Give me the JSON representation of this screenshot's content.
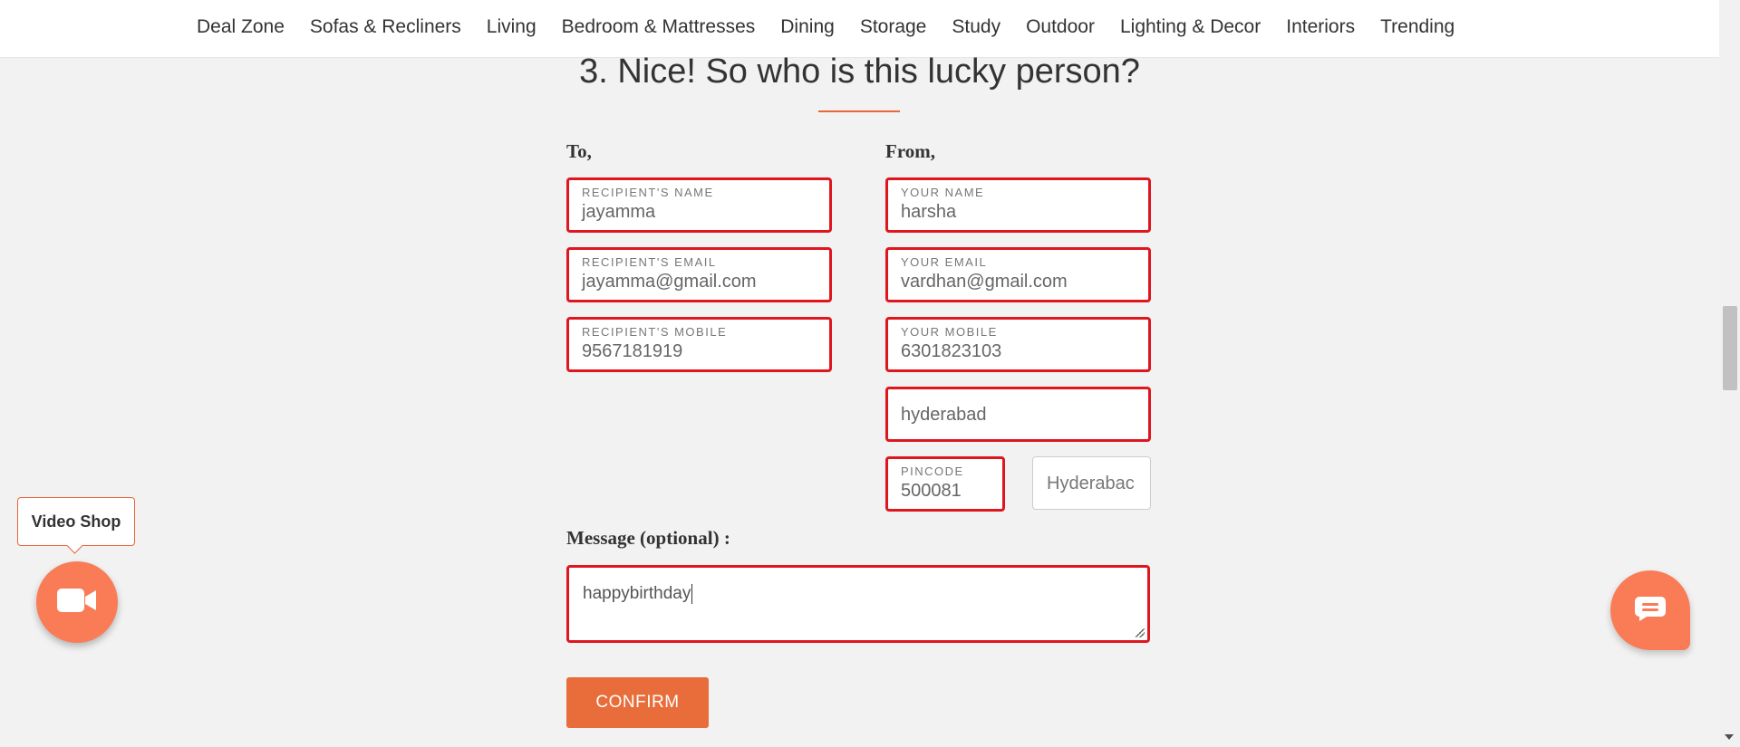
{
  "nav": {
    "items": [
      "Deal Zone",
      "Sofas & Recliners",
      "Living",
      "Bedroom & Mattresses",
      "Dining",
      "Storage",
      "Study",
      "Outdoor",
      "Lighting & Decor",
      "Interiors",
      "Trending"
    ]
  },
  "section": {
    "title": "3. Nice! So who is this lucky person?"
  },
  "to": {
    "label": "To,",
    "name": {
      "label": "RECIPIENT'S NAME",
      "value": "jayamma"
    },
    "email": {
      "label": "RECIPIENT'S EMAIL",
      "value": "jayamma@gmail.com"
    },
    "mobile": {
      "label": "RECIPIENT'S MOBILE",
      "value": "9567181919"
    }
  },
  "from": {
    "label": "From,",
    "name": {
      "label": "YOUR NAME",
      "value": "harsha"
    },
    "email": {
      "label": "YOUR EMAIL",
      "value": "vardhan@gmail.com"
    },
    "mobile": {
      "label": "YOUR MOBILE",
      "value": "6301823103"
    },
    "address": {
      "value": "hyderabad"
    },
    "pincode": {
      "label": "PINCODE",
      "value": "500081"
    },
    "city": {
      "value": "Hyderabac"
    }
  },
  "message": {
    "label": "Message (optional) :",
    "value": "happybirthday"
  },
  "confirm_label": "CONFIRM",
  "video_shop": {
    "label": "Video Shop",
    "icon": "video-camera-icon"
  },
  "chat": {
    "icon": "chat-icon"
  },
  "colors": {
    "accent": "#e86d3a",
    "error_border": "#e0161f",
    "fab": "#f97c57"
  }
}
